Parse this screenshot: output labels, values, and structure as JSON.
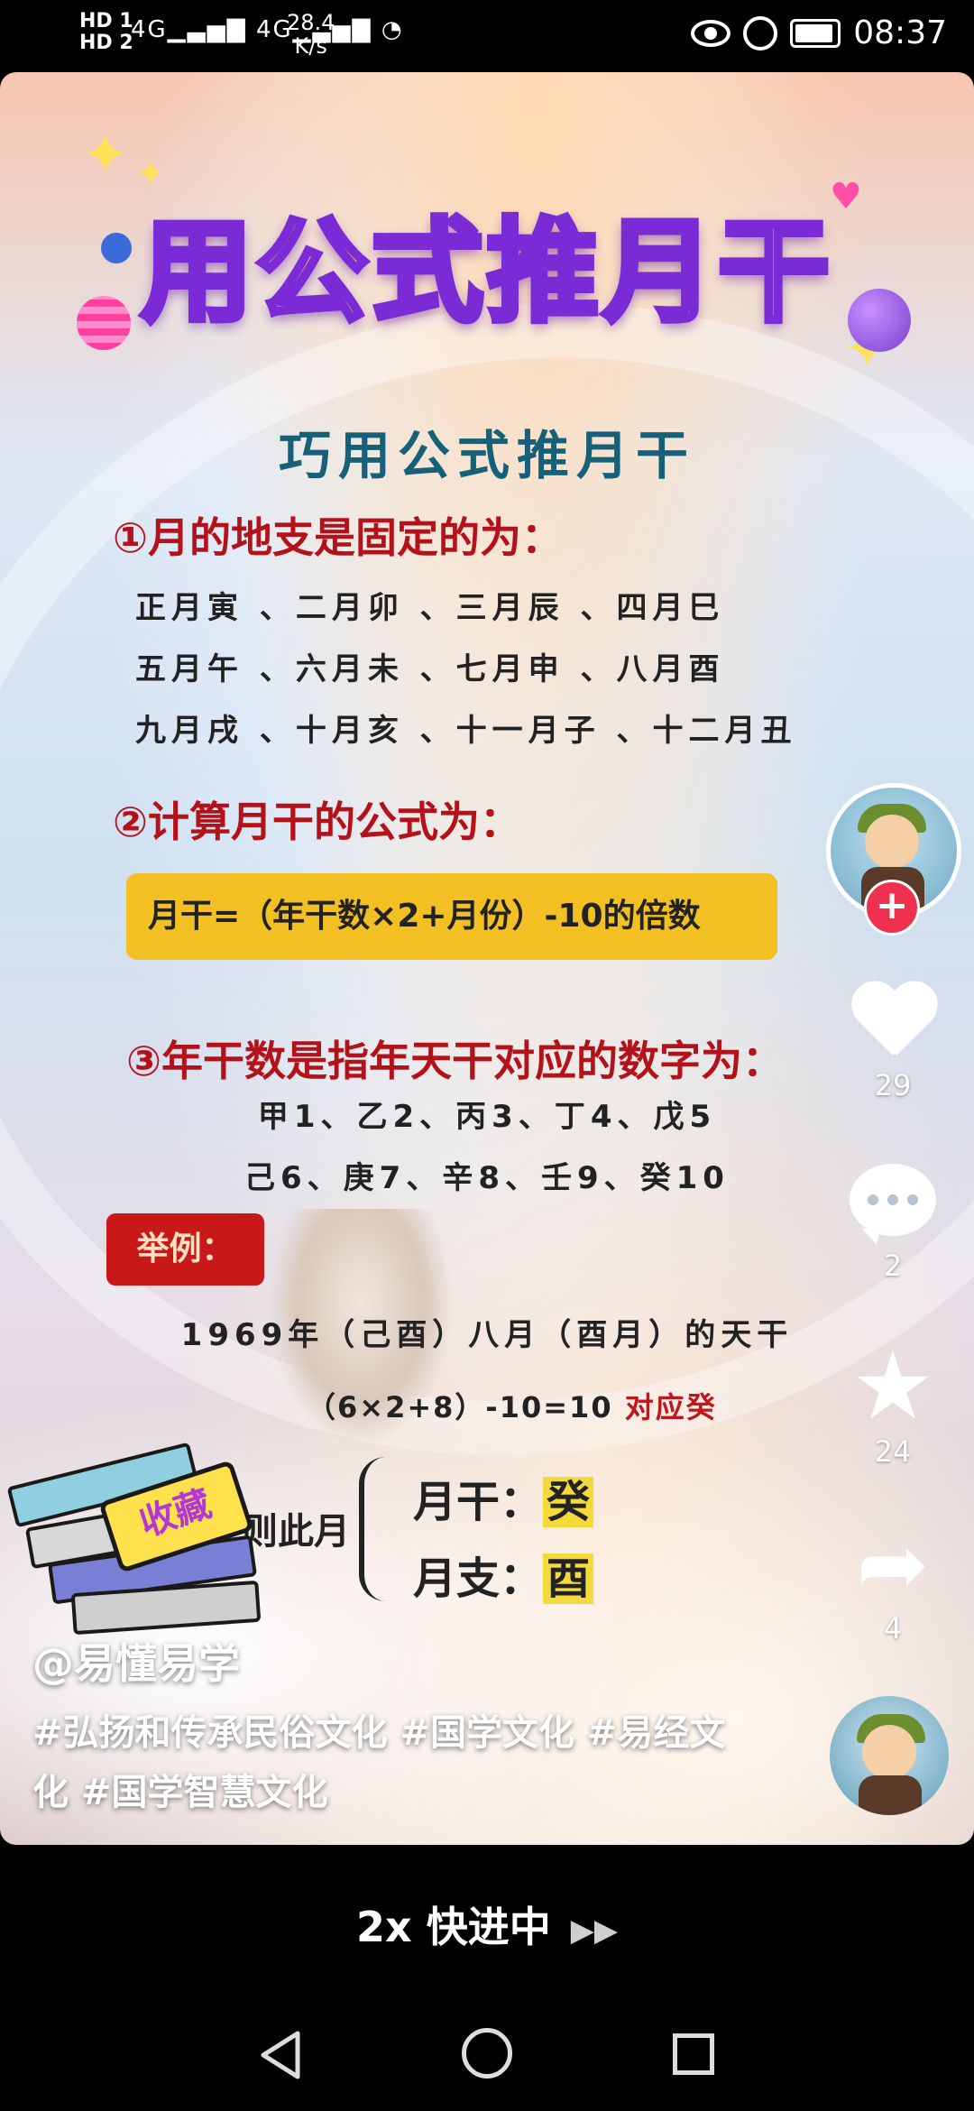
{
  "status_bar": {
    "network_labels": [
      "HD 1",
      "HD 2"
    ],
    "signal_labels": [
      "4G",
      "4G"
    ],
    "speed_value": "28.4",
    "speed_unit": "K/s",
    "time": "08:37",
    "icons": [
      "eye-icon",
      "alarm-icon",
      "battery-icon"
    ]
  },
  "video": {
    "main_title": "用公式推月干",
    "sub_title": "巧用公式推月干",
    "section1": {
      "heading": "①月的地支是固定的为：",
      "lines": [
        "正月寅 、二月卯 、三月辰 、四月巳",
        "五月午 、六月未 、七月申 、八月酉",
        "九月戌 、十月亥 、十一月子 、十二月丑"
      ]
    },
    "section2": {
      "heading": "②计算月干的公式为：",
      "formula": "月干=（年干数×2+月份）-10的倍数"
    },
    "section3": {
      "heading": "③年干数是指年天干对应的数字为：",
      "lines": [
        "甲1、乙2、丙3、丁4、戊5",
        "己6、庚7、辛8、壬9、癸10"
      ]
    },
    "example": {
      "badge": "举例：",
      "line1": "1969年（己酉）八月（酉月）的天干",
      "line2_expr": "（6×2+8）-10=10",
      "line2_result": "对应癸",
      "result_label": "则此月",
      "month_stem_label": "月干：",
      "month_stem_value": "癸",
      "month_branch_label": "月支：",
      "month_branch_value": "酉"
    },
    "sticker_text": "收藏"
  },
  "sidebar": {
    "like_count": "29",
    "comment_count": "2",
    "favorite_count": "24",
    "share_count": "4",
    "follow_symbol": "+"
  },
  "caption": {
    "author": "@易懂易学",
    "tags": "#弘扬和传承民俗文化 #国学文化 #易经文化 #国学智慧文化"
  },
  "playback": {
    "speed_text": "2x 快进中",
    "ff_icon": "fast-forward-icon"
  },
  "nav": [
    "back-icon",
    "home-icon",
    "recents-icon"
  ]
}
